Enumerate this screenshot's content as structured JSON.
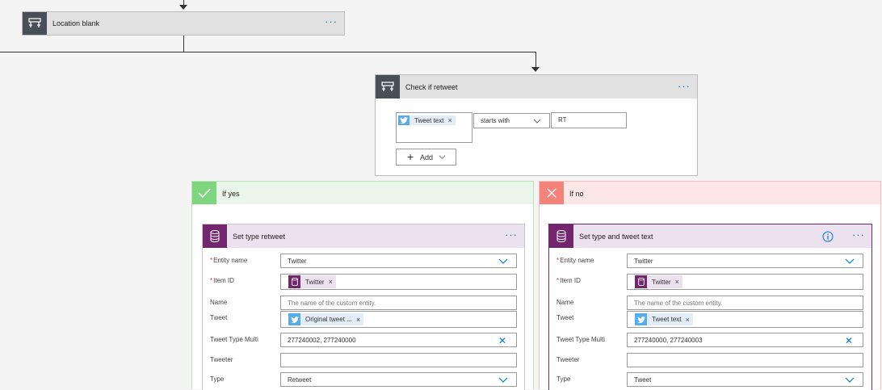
{
  "location_card": {
    "title": "Location blank",
    "more": "···"
  },
  "check_card": {
    "title": "Check if retweet",
    "more": "···",
    "condition": {
      "token": {
        "label": "Tweet text",
        "remove": "×"
      },
      "operator": "starts with",
      "value": "RT"
    },
    "add_label": "Add"
  },
  "if_yes": {
    "title": "If yes",
    "action": {
      "title": "Set type retweet",
      "more": "···",
      "fields": {
        "entity_name": {
          "label": "Entity name",
          "required": "*",
          "value": "Twitter"
        },
        "item_id": {
          "label": "Item ID",
          "required": "*",
          "token": "Twitter",
          "remove": "×"
        },
        "name": {
          "label": "Name",
          "placeholder": "The name of the custom entity."
        },
        "tweet": {
          "label": "Tweet",
          "token": "Original tweet ...",
          "remove": "×"
        },
        "tweet_type_multi": {
          "label": "Tweet Type Multi",
          "value": "277240002, 277240000"
        },
        "tweeter": {
          "label": "Tweeter",
          "value": ""
        },
        "type": {
          "label": "Type",
          "value": "Retweet"
        }
      }
    }
  },
  "if_no": {
    "title": "If no",
    "action": {
      "title": "Set type and tweet text",
      "more": "···",
      "fields": {
        "entity_name": {
          "label": "Entity name",
          "required": "*",
          "value": "Twitter"
        },
        "item_id": {
          "label": "Item ID",
          "required": "*",
          "token": "Twitter",
          "remove": "×"
        },
        "name": {
          "label": "Name",
          "placeholder": "The name of the custom entity."
        },
        "tweet": {
          "label": "Tweet",
          "token": "Tweet text",
          "remove": "×"
        },
        "tweet_type_multi": {
          "label": "Tweet Type Multi",
          "value": "277240000, 277240003"
        },
        "tweeter": {
          "label": "Tweeter",
          "value": ""
        },
        "type": {
          "label": "Type",
          "value": "Tweet"
        }
      }
    }
  },
  "colors": {
    "accent": "#0078d4",
    "condition_icon": "#484f58",
    "action_icon": "#71266e",
    "yes": "#7fd67f",
    "no": "#f4837b",
    "twitter": "#55acee"
  }
}
